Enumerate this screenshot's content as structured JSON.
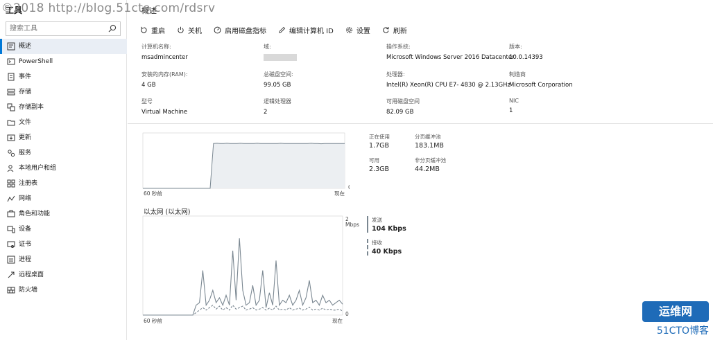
{
  "watermark": {
    "top_text": "©2018 http://blog.51cto.com/rdsrv",
    "logo_line1": "运维网",
    "logo_line2": "51CTO博客"
  },
  "sidebar": {
    "title": "工具",
    "search_placeholder": "搜索工具",
    "items": [
      {
        "label": "概述",
        "icon": "overview-icon",
        "active": true
      },
      {
        "label": "PowerShell",
        "icon": "powershell-icon"
      },
      {
        "label": "事件",
        "icon": "events-icon"
      },
      {
        "label": "存储",
        "icon": "storage-icon"
      },
      {
        "label": "存储副本",
        "icon": "storage-replica-icon"
      },
      {
        "label": "文件",
        "icon": "folder-icon"
      },
      {
        "label": "更新",
        "icon": "update-icon"
      },
      {
        "label": "服务",
        "icon": "services-icon"
      },
      {
        "label": "本地用户和组",
        "icon": "users-icon"
      },
      {
        "label": "注册表",
        "icon": "registry-icon"
      },
      {
        "label": "网络",
        "icon": "network-icon"
      },
      {
        "label": "角色和功能",
        "icon": "roles-icon"
      },
      {
        "label": "设备",
        "icon": "devices-icon"
      },
      {
        "label": "证书",
        "icon": "certificate-icon"
      },
      {
        "label": "进程",
        "icon": "process-icon"
      },
      {
        "label": "远程桌面",
        "icon": "remote-desktop-icon"
      },
      {
        "label": "防火墙",
        "icon": "firewall-icon"
      }
    ]
  },
  "main": {
    "title": "概述",
    "toolbar": {
      "restart": "重启",
      "shutdown": "关机",
      "enable_disk_metrics": "启用磁盘指标",
      "edit_computer_id": "编辑计算机 ID",
      "settings": "设置",
      "refresh": "刷新"
    },
    "properties": {
      "computer_name_label": "计算机名称:",
      "computer_name": "msadmincenter",
      "domain_label": "域:",
      "os_label": "操作系统:",
      "os": "Microsoft Windows Server 2016 Datacenter",
      "version_label": "版本:",
      "version": "10.0.14393",
      "ram_label": "安装的内存(RAM):",
      "ram": "4 GB",
      "disk_label": "总磁盘空间:",
      "disk": "99.05 GB",
      "cpu_label": "处理器:",
      "cpu": "Intel(R) Xeon(R) CPU E7- 4830 @ 2.13GHz",
      "manufacturer_label": "制造商",
      "manufacturer": "Microsoft Corporation",
      "model_label": "型号",
      "model": "Virtual Machine",
      "logical_cpu_label": "逻辑处理器",
      "logical_cpu": "2",
      "free_disk_label": "可用磁盘空间",
      "free_disk": "82.09 GB",
      "nic_label": "NIC",
      "nic": "1"
    },
    "memory": {
      "axis_left": "60 秒前",
      "axis_right": "现在",
      "axis_zero": "0",
      "in_use_label": "正在使用",
      "in_use": "1.7GB",
      "paged_pool_label": "分页缓冲池",
      "paged_pool": "183.1MB",
      "available_label": "可用",
      "available": "2.3GB",
      "nonpaged_pool_label": "非分页缓冲池",
      "nonpaged_pool": "44.2MB"
    },
    "network": {
      "title": "以太网 (以太网)",
      "axis_max": "2",
      "axis_unit": "Mbps",
      "axis_left": "60 秒前",
      "axis_right": "现在",
      "axis_zero": "0",
      "send_label": "发送",
      "send": "104 Kbps",
      "receive_label": "接收",
      "receive": "40 Kbps"
    }
  },
  "chart_data": [
    {
      "type": "area",
      "x_range": [
        -60,
        0
      ],
      "xlabel": "",
      "ylabel": "",
      "series": [
        {
          "values": [
            0,
            0,
            0,
            0,
            0,
            0,
            0,
            0,
            0,
            0,
            0,
            0,
            0,
            0,
            0,
            0,
            0,
            0,
            0,
            0,
            0,
            1.7,
            1.71,
            1.7,
            1.7,
            1.71,
            1.7,
            1.7,
            1.7,
            1.71,
            1.7,
            1.7,
            1.7,
            1.7,
            1.71,
            1.7,
            1.7,
            1.7,
            1.7,
            1.7,
            1.7,
            1.71,
            1.7,
            1.7,
            1.7,
            1.7,
            1.7,
            1.7,
            1.7,
            1.7,
            1.71,
            1.7,
            1.7,
            1.69,
            1.7,
            1.7,
            1.7,
            1.7,
            1.7,
            1.7,
            1.7
          ]
        }
      ],
      "ylim": [
        0,
        2.1
      ]
    },
    {
      "type": "line",
      "x_range": [
        -60,
        0
      ],
      "ylim": [
        0,
        2
      ],
      "series": [
        {
          "line_style": "solid",
          "values": [
            0,
            0,
            0,
            0,
            0,
            0,
            0,
            0,
            0,
            0,
            0,
            0,
            0,
            0,
            0,
            0,
            0.2,
            0.25,
            0.9,
            0.2,
            0.3,
            0.5,
            0.25,
            0.35,
            0.2,
            0.4,
            0.2,
            1.3,
            0.3,
            1.55,
            0.5,
            0.2,
            0.25,
            0.6,
            0.2,
            0.3,
            0.9,
            0.15,
            0.45,
            0.2,
            1.1,
            0.2,
            0.3,
            0.25,
            0.4,
            0.2,
            0.3,
            0.5,
            0.2,
            0.35,
            0.7,
            0.25,
            0.3,
            0.2,
            0.4,
            0.25,
            0.3,
            0.2,
            0.25,
            0.3,
            0.22
          ]
        },
        {
          "line_style": "dashed",
          "values": [
            0,
            0,
            0,
            0,
            0,
            0,
            0,
            0,
            0,
            0,
            0,
            0,
            0,
            0,
            0,
            0,
            0.05,
            0.1,
            0.15,
            0.1,
            0.15,
            0.2,
            0.12,
            0.18,
            0.1,
            0.15,
            0.1,
            0.2,
            0.12,
            0.15,
            0.18,
            0.1,
            0.12,
            0.15,
            0.1,
            0.12,
            0.15,
            0.1,
            0.14,
            0.1,
            0.18,
            0.1,
            0.12,
            0.1,
            0.15,
            0.1,
            0.12,
            0.14,
            0.1,
            0.12,
            0.16,
            0.1,
            0.12,
            0.1,
            0.14,
            0.1,
            0.12,
            0.1,
            0.1,
            0.12,
            0.08
          ]
        }
      ]
    }
  ]
}
